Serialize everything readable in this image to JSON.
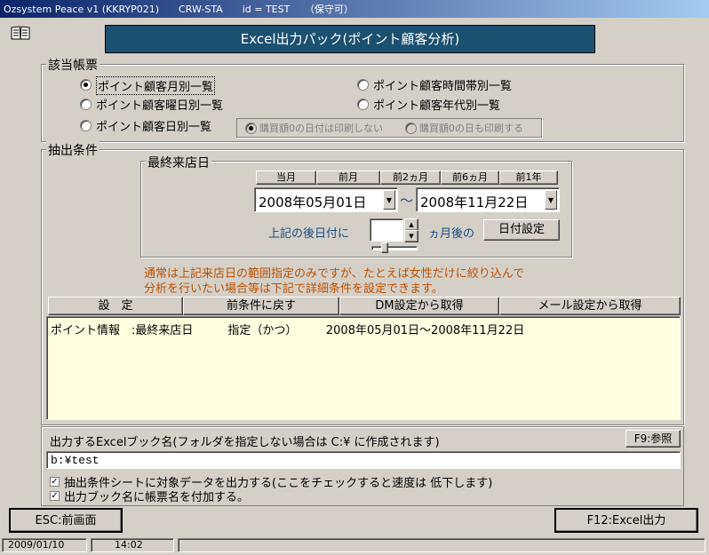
{
  "window": {
    "title": "Ozsystem Peace v1 (KKRYP021)　　CRW-STA　　id = TEST　　（保守可）"
  },
  "banner": {
    "title": "Excel出力パック(ポイント顧客分析)"
  },
  "report_group": {
    "legend": "該当帳票",
    "options": [
      {
        "label": "ポイント顧客月別一覧",
        "selected": true
      },
      {
        "label": "ポイント顧客曜日別一覧",
        "selected": false
      },
      {
        "label": "ポイント顧客日別一覧",
        "selected": false
      },
      {
        "label": "ポイント顧客時間帯別一覧",
        "selected": false
      },
      {
        "label": "ポイント顧客年代別一覧",
        "selected": false
      }
    ],
    "print_options": [
      "購買額0の日付は印刷しない",
      "購買額0の日も印刷する"
    ]
  },
  "extract_group": {
    "legend": "抽出条件",
    "last_visit": {
      "legend": "最終来店日",
      "quick_buttons": [
        "当月",
        "前月",
        "前2ヵ月",
        "前6ヵ月",
        "前1年"
      ],
      "date_from": "2008年05月01日",
      "tilde": "～",
      "date_to": "2008年11月22日",
      "after_label": "上記の後日付に",
      "month_value": "",
      "months_after_label": "ヵ月後の",
      "set_date_button": "日付設定"
    },
    "note_line1": "通常は上記来店日の範囲指定のみですが、たとえば女性だけに絞り込んで",
    "note_line2": "分析を行いたい場合等は下記で詳細条件を設定できます。",
    "condition_buttons": [
      "設　定",
      "前条件に戻す",
      "DM設定から取得",
      "メール設定から取得"
    ],
    "condition_text": "ポイント情報　:最終来店日　　　指定（かつ）　　　2008年05月01日～2008年11月22日"
  },
  "output": {
    "label": "出力するExcelブック名(フォルダを指定しない場合は C:¥ に作成されます)",
    "browse_button": "F9:参照",
    "filename": "b:¥test",
    "check1": "抽出条件シートに対象データを出力する(ここをチェックすると速度は 低下します)",
    "check2": "出力ブック名に帳票名を付加する。"
  },
  "footer": {
    "esc_button": "ESC:前画面",
    "excel_button": "F12:Excel出力"
  },
  "status": {
    "date": "2009/01/10",
    "time": "14:02"
  }
}
